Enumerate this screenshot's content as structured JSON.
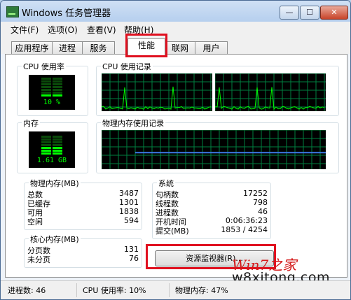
{
  "window": {
    "title": "Windows 任务管理器",
    "buttons": {
      "minimize": "—",
      "maximize": "☐",
      "close": "✕"
    }
  },
  "menu": [
    "文件(F)",
    "选项(O)",
    "查看(V)",
    "帮助(H)"
  ],
  "tabs": [
    "应用程序",
    "进程",
    "服务",
    "性能",
    "联网",
    "用户"
  ],
  "active_tab": "性能",
  "cpu": {
    "usage_title": "CPU 使用率",
    "usage_value": "10 %",
    "usage_fraction": 0.1,
    "history_title": "CPU 使用记录"
  },
  "memory": {
    "usage_title": "内存",
    "usage_value": "1.61 GB",
    "usage_fraction": 0.47,
    "history_title": "物理内存使用记录"
  },
  "physical_memory": {
    "title": "物理内存(MB)",
    "rows": [
      {
        "label": "总数",
        "value": "3487"
      },
      {
        "label": "已缓存",
        "value": "1301"
      },
      {
        "label": "可用",
        "value": "1838"
      },
      {
        "label": "空闲",
        "value": "594"
      }
    ]
  },
  "kernel_memory": {
    "title": "核心内存(MB)",
    "rows": [
      {
        "label": "分页数",
        "value": "131"
      },
      {
        "label": "未分页",
        "value": "76"
      }
    ]
  },
  "system": {
    "title": "系统",
    "rows": [
      {
        "label": "句柄数",
        "value": "17252"
      },
      {
        "label": "线程数",
        "value": "798"
      },
      {
        "label": "进程数",
        "value": "46"
      },
      {
        "label": "开机时间",
        "value": "0:06:36:23"
      },
      {
        "label": "提交(MB)",
        "value": "1853 / 4254"
      }
    ]
  },
  "resource_monitor_button": "资源监视器(R)...",
  "status": {
    "processes": "进程数: 46",
    "cpu": "CPU 使用率: 10%",
    "memory": "物理内存: 47%"
  },
  "watermark": {
    "logo": "Win7之家",
    "url": "w8xitong.com"
  },
  "colors": {
    "graph_green": "#00ff00",
    "grid_green": "#008040",
    "memory_line": "#3c78e6",
    "highlight_red": "#e0101f"
  }
}
